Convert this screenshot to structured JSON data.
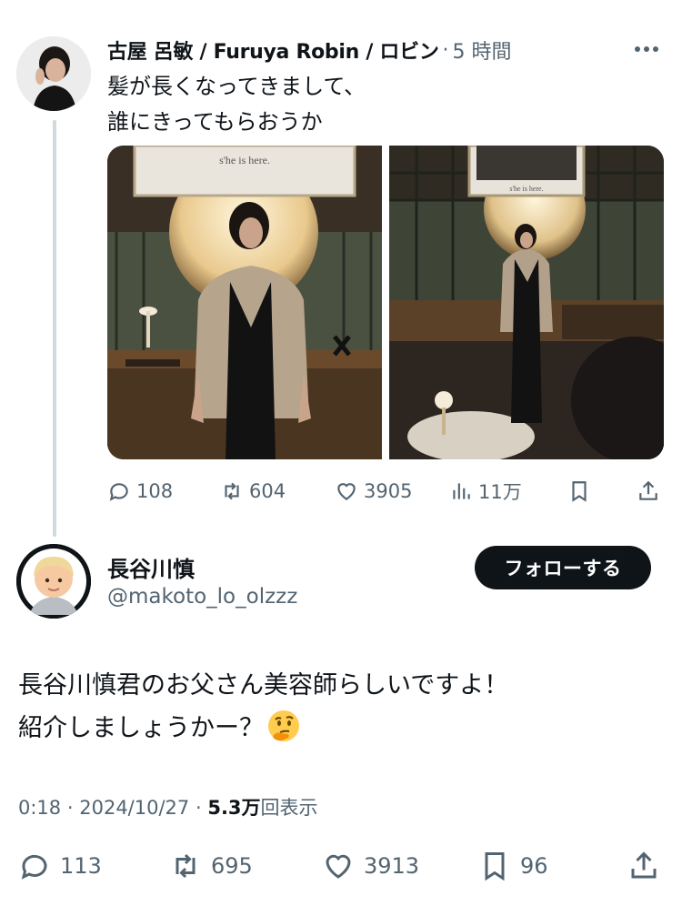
{
  "parent_tweet": {
    "author": "古屋 呂敏 / Furuya Robin / ロビン",
    "separator": "·",
    "time": "5 時間",
    "text_line1": "髪が長くなってきまして、",
    "text_line2": "誰にきってもらおうか",
    "photo1_sign": "s'he is here.",
    "photo2_sign": "s'he is here.",
    "replies": "108",
    "retweets": "604",
    "likes": "3905",
    "views": "11万"
  },
  "main_tweet": {
    "display_name": "長谷川慎",
    "handle": "@makoto_lo_olzzz",
    "follow_label": "フォローする",
    "text_line1": "長谷川慎君のお父さん美容師らしいですよ！",
    "text_line2": "紹介しましょうかー？",
    "emoji": "thinking-face",
    "time": "0:18",
    "dot1": "·",
    "date": "2024/10/27",
    "dot2": "·",
    "view_count": "5.3万",
    "view_label": "回表示",
    "replies": "113",
    "retweets": "695",
    "likes": "3913",
    "bookmarks": "96"
  },
  "colors": {
    "text": "#0f1419",
    "muted": "#536471",
    "divider": "#cfd9de",
    "button": "#0f1419"
  },
  "icons": [
    "more-icon",
    "reply-icon",
    "retweet-icon",
    "like-icon",
    "views-icon",
    "bookmark-icon",
    "share-icon"
  ]
}
